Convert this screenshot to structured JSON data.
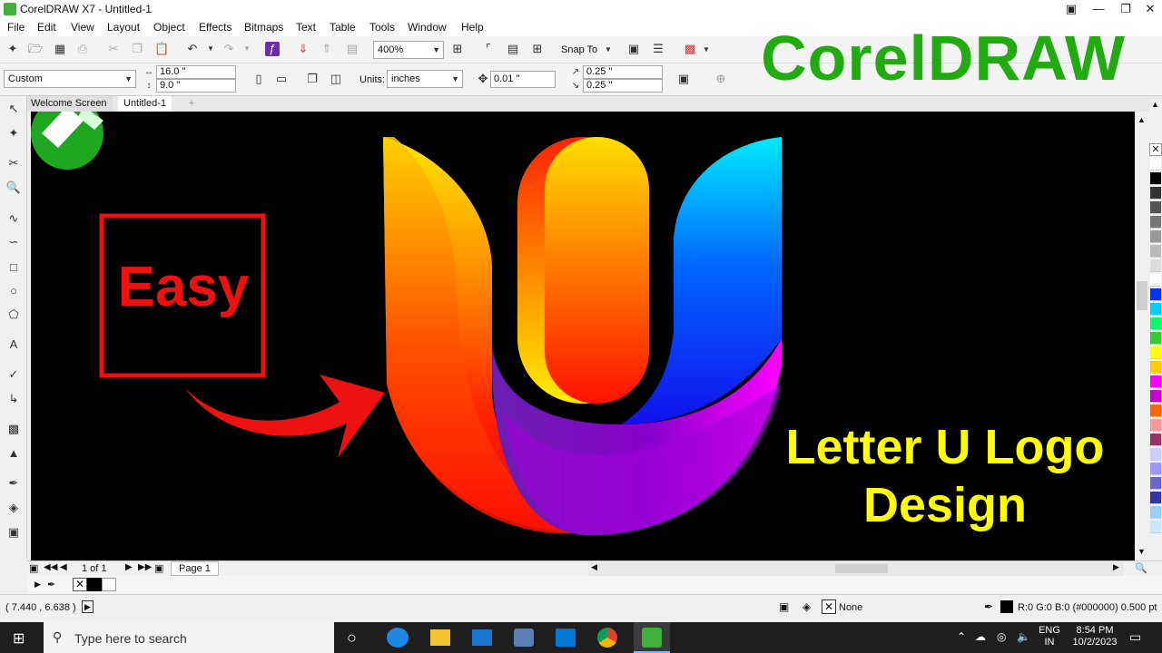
{
  "window": {
    "title": "CorelDRAW X7 - Untitled-1"
  },
  "menu": [
    "File",
    "Edit",
    "View",
    "Layout",
    "Object",
    "Effects",
    "Bitmaps",
    "Text",
    "Table",
    "Tools",
    "Window",
    "Help"
  ],
  "toolbar": {
    "zoom": "400%",
    "snap_to": "Snap To"
  },
  "property_bar": {
    "page_preset": "Custom",
    "width": "16.0 \"",
    "height": "9.0 \"",
    "units_label": "Units:",
    "units_value": "inches",
    "nudge": "0.01 \"",
    "dup_x": "0.25 \"",
    "dup_y": "0.25 \""
  },
  "doc_tabs": [
    "Welcome Screen",
    "Untitled-1"
  ],
  "overlay": {
    "brand": "CorelDRAW",
    "badge": "Easy",
    "headline_line1": "Letter U Logo",
    "headline_line2": "Design",
    "brand_color": "#22aa11",
    "badge_color": "#ee1111",
    "headline_color": "#ffff00"
  },
  "pagebar": {
    "page_count": "1 of 1",
    "page_tab": "Page 1"
  },
  "status": {
    "coords": "( 7.440 , 6.638 )",
    "fill_none": "None",
    "outline_info": "R:0 G:0 B:0 (#000000)  0.500 pt"
  },
  "taskbar": {
    "search_placeholder": "Type here to search",
    "lang_line1": "ENG",
    "lang_line2": "IN",
    "time": "8:54 PM",
    "date": "10/2/2023"
  },
  "palette_colors": [
    "#ffffff",
    "#000000",
    "#333333",
    "#555555",
    "#777777",
    "#999999",
    "#bbbbbb",
    "#dddddd",
    "#ffffff",
    "#0033ff",
    "#00ccff",
    "#00ff66",
    "#33cc33",
    "#ffff00",
    "#ffcc00",
    "#ff00ff",
    "#cc00cc",
    "#ff6600",
    "#ff9999",
    "#993366",
    "#ccccff",
    "#9999ff",
    "#6666cc",
    "#3333aa",
    "#99ccff",
    "#cce6ff"
  ]
}
